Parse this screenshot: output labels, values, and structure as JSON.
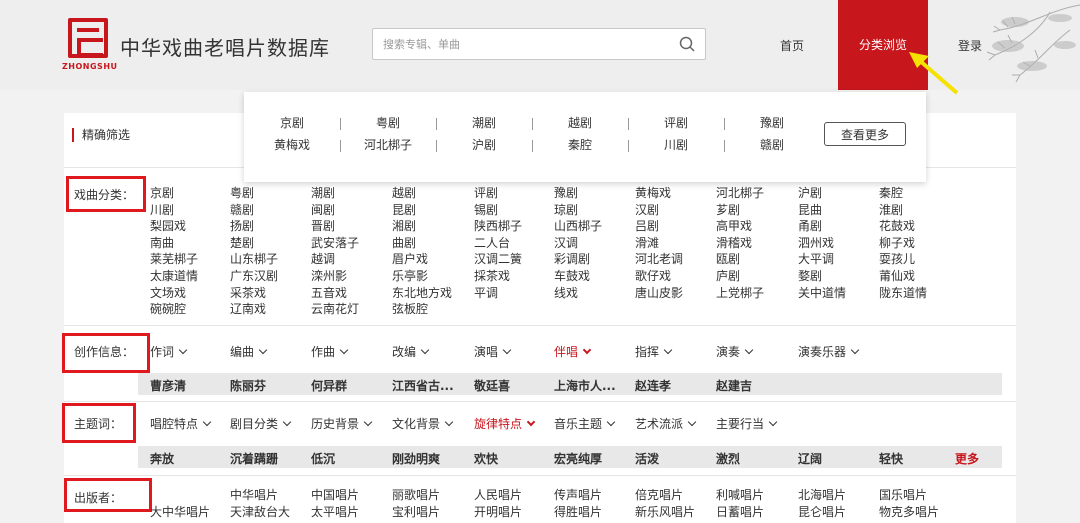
{
  "header": {
    "logo_text": "ZHONGSHU",
    "site_title": "中华戏曲老唱片数据库",
    "search_placeholder": "搜索专辑、单曲",
    "nav": {
      "home": "首页",
      "browse": "分类浏览",
      "login": "登录"
    }
  },
  "dropdown": {
    "rows": [
      [
        "京剧",
        "粤剧",
        "潮剧",
        "越剧",
        "评剧",
        "豫剧"
      ],
      [
        "黄梅戏",
        "河北梆子",
        "沪剧",
        "秦腔",
        "川剧",
        "赣剧"
      ]
    ],
    "more_label": "查看更多"
  },
  "panel": {
    "precise_filter": "精确筛选",
    "genre": {
      "label": "戏曲分类：",
      "rows": [
        [
          "京剧",
          "粤剧",
          "潮剧",
          "越剧",
          "评剧",
          "豫剧",
          "黄梅戏",
          "河北梆子",
          "沪剧",
          "秦腔"
        ],
        [
          "川剧",
          "赣剧",
          "闽剧",
          "昆剧",
          "锡剧",
          "琼剧",
          "汉剧",
          "芗剧",
          "昆曲",
          "淮剧"
        ],
        [
          "梨园戏",
          "扬剧",
          "晋剧",
          "湘剧",
          "陕西梆子",
          "山西梆子",
          "吕剧",
          "高甲戏",
          "甬剧",
          "花鼓戏"
        ],
        [
          "南曲",
          "楚剧",
          "武安落子",
          "曲剧",
          "二人台",
          "汉调",
          "滑滩",
          "滑稽戏",
          "泗州戏",
          "柳子戏"
        ],
        [
          "莱芜梆子",
          "山东梆子",
          "越调",
          "眉户戏",
          "汉调二簧",
          "彩调剧",
          "河北老调",
          "瓯剧",
          "大平调",
          "耍孩儿"
        ],
        [
          "太康道情",
          "广东汉剧",
          "滦州影",
          "乐亭影",
          "採茶戏",
          "车鼓戏",
          "歌仔戏",
          "庐剧",
          "婺剧",
          "莆仙戏"
        ],
        [
          "文场戏",
          "采茶戏",
          "五音戏",
          "东北地方戏",
          "平调",
          "线戏",
          "唐山皮影",
          "上党梆子",
          "关中道情",
          "陇东道情"
        ],
        [
          "碗碗腔",
          "辽南戏",
          "云南花灯",
          "弦板腔"
        ]
      ]
    },
    "creation": {
      "label": "创作信息：",
      "filters": [
        "作词",
        "编曲",
        "作曲",
        "改编",
        "演唱",
        "伴唱",
        "指挥",
        "演奏",
        "演奏乐器"
      ],
      "active_index": 5,
      "bar": [
        "曹彦清",
        "陈丽芬",
        "何异群",
        "江西省古...",
        "敬廷喜",
        "上海市人...",
        "赵连孝",
        "赵建吉"
      ]
    },
    "theme": {
      "label": "主题词：",
      "filters": [
        "唱腔特点",
        "剧目分类",
        "历史背景",
        "文化背景",
        "旋律特点",
        "音乐主题",
        "艺术流派",
        "主要行当"
      ],
      "active_index": 4,
      "bar": [
        "奔放",
        "沉着蹒跚",
        "低沉",
        "刚劲明爽",
        "欢快",
        "宏亮纯厚",
        "活泼",
        "激烈",
        "辽阔",
        "轻快"
      ],
      "more_label": "更多"
    },
    "publisher": {
      "label": "出版者：",
      "rows": [
        [
          "",
          "中华唱片",
          "中国唱片",
          "丽歌唱片",
          "人民唱片",
          "传声唱片",
          "倍克唱片",
          "利喊唱片",
          "北海唱片",
          "国乐唱片"
        ],
        [
          "大中华唱片",
          "天津敌台大",
          "太平唱片",
          "宝利唱片",
          "开明唱片",
          "得胜唱片",
          "新乐风唱片",
          "日蓄唱片",
          "昆仑唱片",
          "物克多唱片"
        ]
      ]
    }
  },
  "colors": {
    "brand_red": "#c8161d",
    "annotation_red": "#e0191e",
    "arrow_yellow": "#f5e200"
  }
}
